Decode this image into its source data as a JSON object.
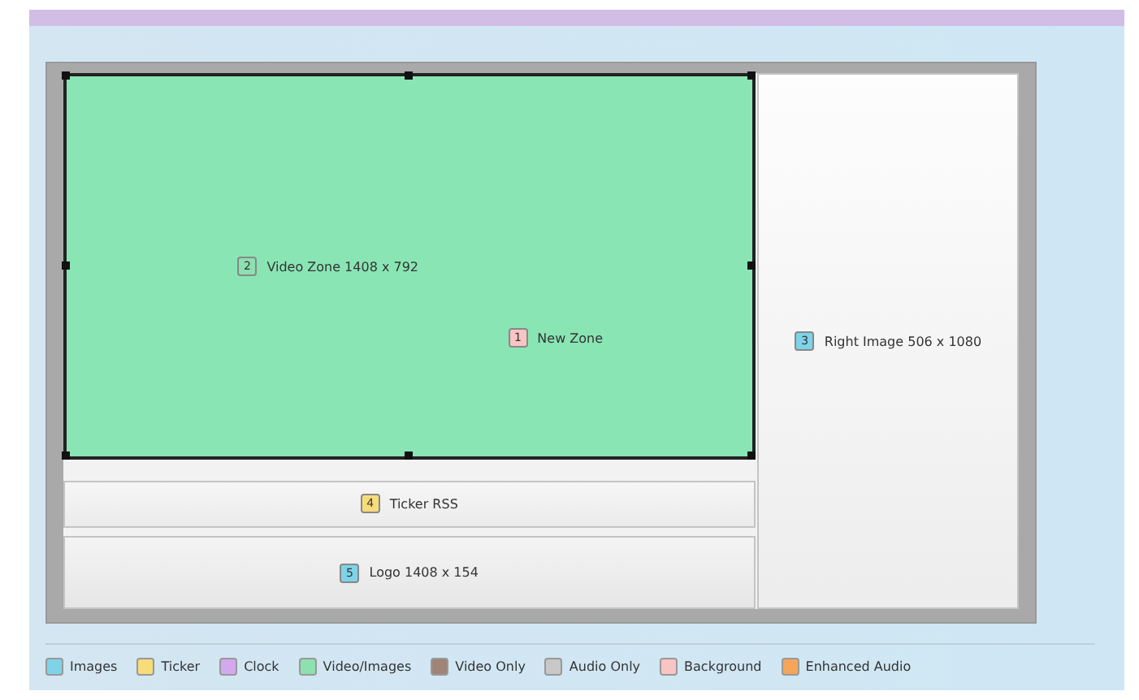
{
  "zones": [
    {
      "number": "1",
      "label": "New Zone",
      "color": "#f8c4c4",
      "kind": "background",
      "selected": false
    },
    {
      "number": "2",
      "label": "Video Zone 1408 x 792",
      "color": "#8de0b0",
      "kind": "video",
      "selected": true
    },
    {
      "number": "3",
      "label": "Right Image 506 x 1080",
      "color": "#7fd3e8",
      "kind": "right",
      "selected": false
    },
    {
      "number": "4",
      "label": "Ticker RSS",
      "color": "#f7dc7a",
      "kind": "ticker",
      "selected": false
    },
    {
      "number": "5",
      "label": "Logo 1408 x 154",
      "color": "#7fd3e8",
      "kind": "logo",
      "selected": false
    }
  ],
  "legend": [
    {
      "label": "Images",
      "color": "#7fd3e8"
    },
    {
      "label": "Ticker",
      "color": "#f7dc7a"
    },
    {
      "label": "Clock",
      "color": "#d4a8ef"
    },
    {
      "label": "Video/Images",
      "color": "#8de0b0"
    },
    {
      "label": "Video Only",
      "color": "#a08478"
    },
    {
      "label": "Audio Only",
      "color": "#c8c8c8"
    },
    {
      "label": "Background",
      "color": "#f8c4c4"
    },
    {
      "label": "Enhanced Audio",
      "color": "#f5a55a"
    }
  ]
}
